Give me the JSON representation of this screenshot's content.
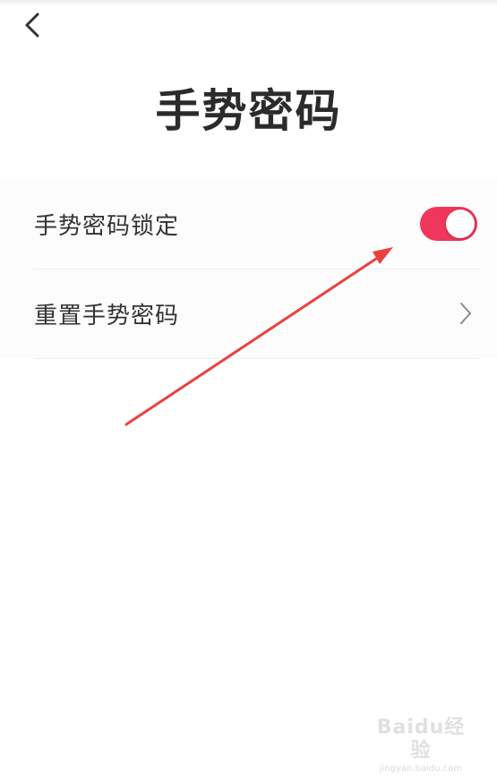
{
  "header": {
    "back_icon": "chevron-left-icon"
  },
  "page": {
    "title": "手势密码"
  },
  "settings": {
    "lock_label": "手势密码锁定",
    "lock_enabled": true,
    "reset_label": "重置手势密码",
    "reset_icon": "chevron-right-icon"
  },
  "colors": {
    "toggle_on": "#f0365a",
    "arrow": "#e8423f"
  },
  "watermark": {
    "logo": "Baidu经验",
    "url": "jingyan.baidu.com"
  }
}
